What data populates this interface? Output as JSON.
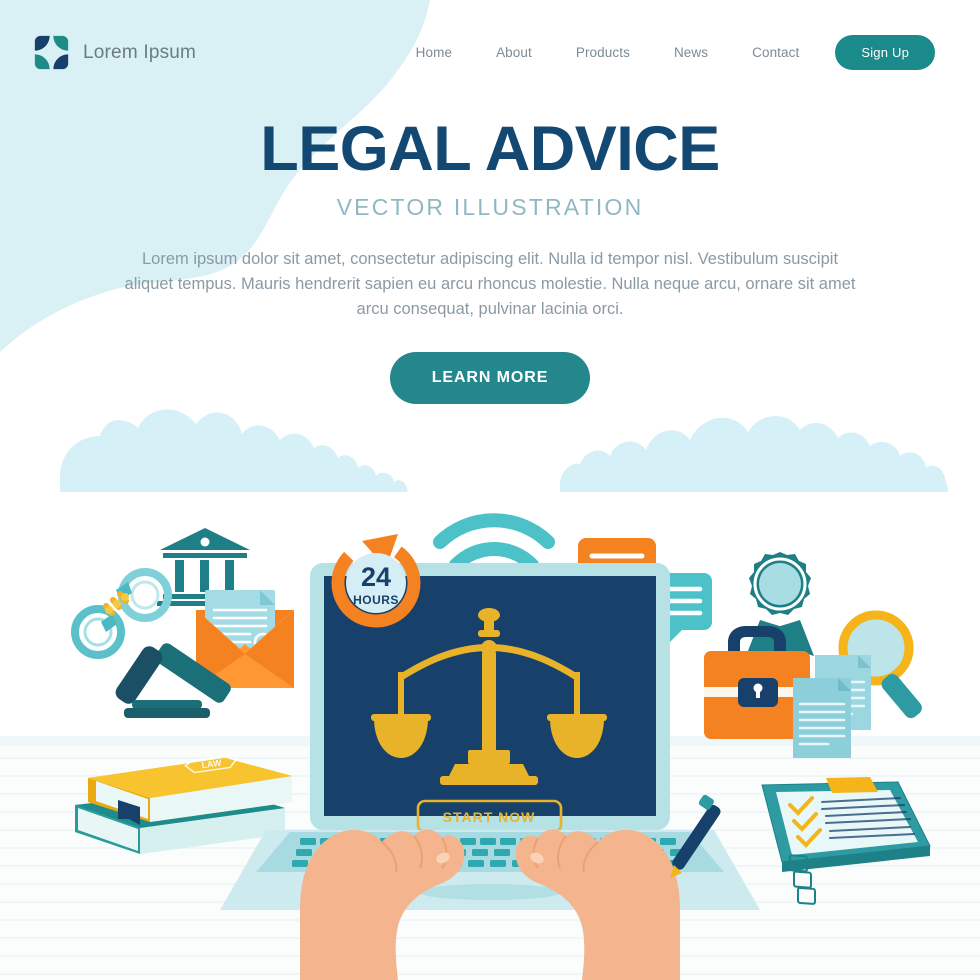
{
  "brand": {
    "name": "Lorem Ipsum",
    "logo_icon": "four-petal-logo-icon"
  },
  "nav": {
    "items": [
      {
        "label": "Home"
      },
      {
        "label": "About"
      },
      {
        "label": "Products"
      },
      {
        "label": "News"
      },
      {
        "label": "Contact"
      }
    ],
    "signup_label": "Sign Up"
  },
  "hero": {
    "title": "LEGAL ADVICE",
    "subtitle": "VECTOR  ILLUSTRATION",
    "body": "Lorem ipsum dolor sit amet, consectetur adipiscing elit. Nulla id tempor nisl. Vestibulum suscipit aliquet tempus. Mauris hendrerit sapien eu arcu rhoncus molestie. Nulla neque arcu, ornare sit amet arcu consequat, pulvinar lacinia orci.",
    "cta_label": "LEARN MORE"
  },
  "illustration": {
    "laptop_screen": {
      "cta_label": "START NOW",
      "scales_icon": "scales-of-justice-icon"
    },
    "badge_24h": {
      "number": "24",
      "unit": "HOURS"
    },
    "book_label": "LAW",
    "icons": [
      {
        "name": "courthouse-icon"
      },
      {
        "name": "handcuffs-icon"
      },
      {
        "name": "gavel-icon"
      },
      {
        "name": "envelope-document-icon"
      },
      {
        "name": "law-books-icon"
      },
      {
        "name": "wifi-icon"
      },
      {
        "name": "chat-bubble-orange-icon"
      },
      {
        "name": "chat-bubble-teal-icon"
      },
      {
        "name": "award-seal-icon"
      },
      {
        "name": "magnifier-icon"
      },
      {
        "name": "briefcase-icon"
      },
      {
        "name": "documents-icon"
      },
      {
        "name": "clipboard-checklist-icon"
      },
      {
        "name": "pen-icon"
      }
    ]
  },
  "colors": {
    "navy": "#134872",
    "teal": "#23878b",
    "teal_light": "#4cc2c8",
    "orange": "#f58220",
    "gold": "#e8b329",
    "pale_blue": "#d9f0f5",
    "screen_navy": "#123a5e",
    "muted_text": "#8a9aa5"
  }
}
